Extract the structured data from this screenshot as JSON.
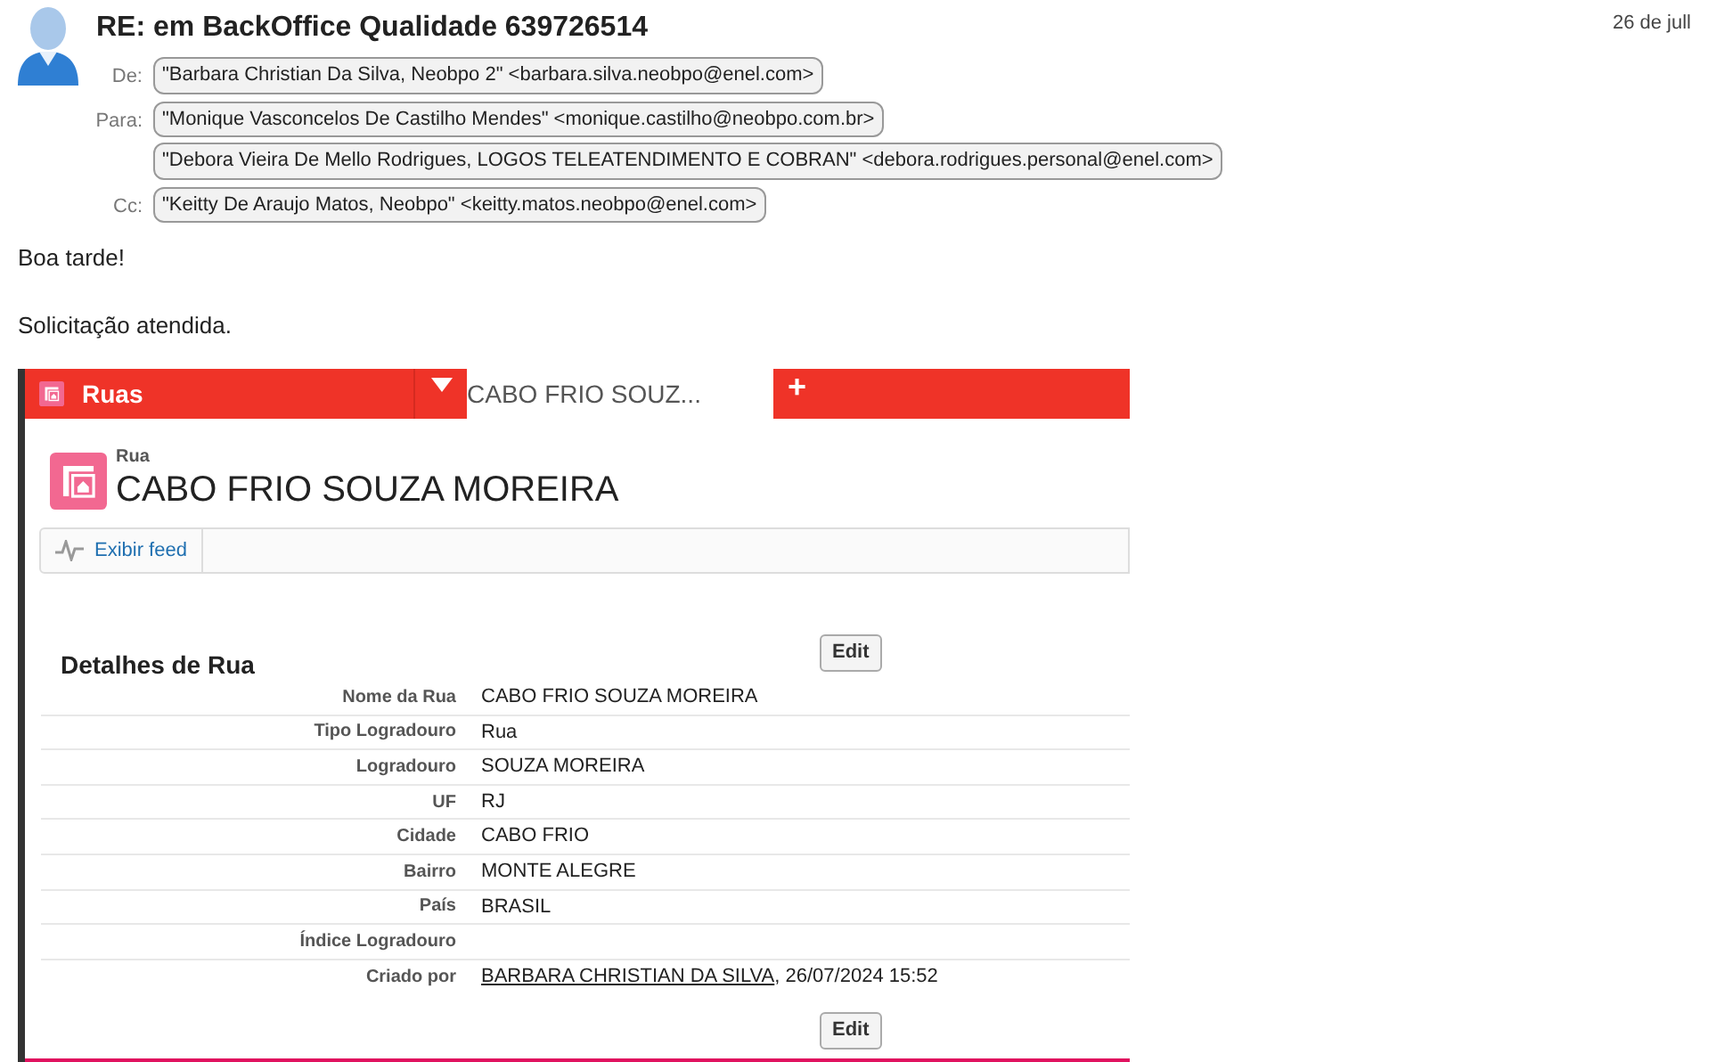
{
  "email": {
    "subject": "RE: em BackOffice Qualidade 639726514",
    "date": "26 de jull",
    "headers": [
      {
        "label": "De:",
        "addresses": [
          "\"Barbara Christian Da Silva, Neobpo 2\" <barbara.silva.neobpo@enel.com>"
        ]
      },
      {
        "label": "Para:",
        "addresses": [
          "\"Monique Vasconcelos De Castilho Mendes\" <monique.castilho@neobpo.com.br>",
          "\"Debora Vieira De Mello Rodrigues, LOGOS TELEATENDIMENTO E COBRAN\" <debora.rodrigues.personal@enel.com>"
        ]
      },
      {
        "label": "Cc:",
        "addresses": [
          "\"Keitty De Araujo Matos, Neobpo\" <keitty.matos.neobpo@enel.com>"
        ]
      }
    ],
    "body": [
      "Boa tarde!",
      "Solicitação atendida."
    ]
  },
  "screenshot": {
    "tabs": [
      {
        "label": "Ruas",
        "selected": false
      },
      {
        "label": "CABO FRIO SOUZ...",
        "selected": true
      }
    ],
    "add_tab": "+",
    "record_type": "Rua",
    "record_title": "CABO FRIO SOUZA MOREIRA",
    "feed_button": "Exibir feed",
    "section_title": "Detalhes de Rua",
    "edit_button": "Edit",
    "fields": [
      {
        "label": "Nome da Rua",
        "value": "CABO FRIO SOUZA MOREIRA"
      },
      {
        "label": "Tipo Logradouro",
        "value": "Rua"
      },
      {
        "label": "Logradouro",
        "value": "SOUZA MOREIRA"
      },
      {
        "label": "UF",
        "value": "RJ"
      },
      {
        "label": "Cidade",
        "value": "CABO FRIO"
      },
      {
        "label": "Bairro",
        "value": "MONTE ALEGRE"
      },
      {
        "label": "País",
        "value": "BRASIL"
      },
      {
        "label": "Índice Logradouro"
      },
      {
        "label": "Criado por",
        "link": "BARBARA CHRISTIAN DA SILVA",
        "value": ", 26/07/2024 15:52"
      }
    ],
    "edit_button_bottom": "Edit"
  }
}
